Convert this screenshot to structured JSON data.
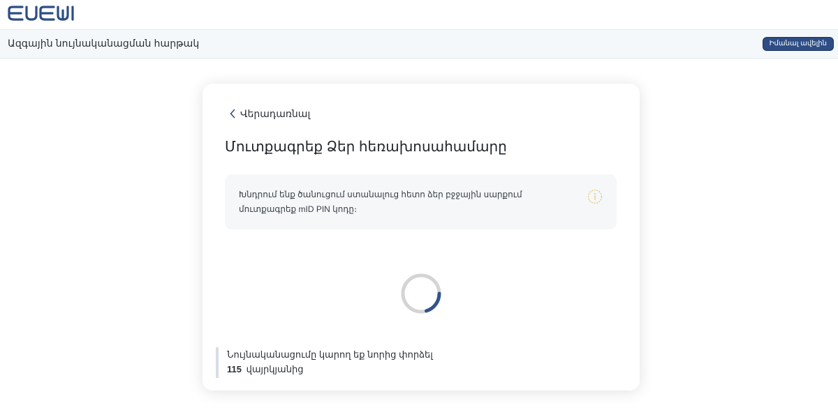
{
  "header": {
    "logo_alt": "ԵԿԵՄ",
    "title": "Ազգային նույնականացման հարթակ",
    "learn_more_label": "Իմանալ ավելին"
  },
  "card": {
    "back_label": "Վերադառնալ",
    "title": "Մուտքագրեք Ձեր հեռախոսահամարը",
    "info_text": "Խնդրում ենք ծանուցում ստանալուց հետո ձեր բջջային սարքում մուտքագրեք mID PIN կոդը։",
    "retry_text": "Նույնականացումը կարող եք նորից փորձել",
    "retry_seconds": "115",
    "retry_suffix": "վայրկյանից"
  },
  "colors": {
    "brand": "#2d4d84",
    "subheader_bg": "#f5f8fa",
    "info_bg": "#f5f7f9",
    "info_icon": "#e8c26a",
    "spinner_track": "#d4d4d4",
    "spinner_arc": "#34538a"
  },
  "icons": {
    "back": "chevron-left-icon",
    "info": "info-icon",
    "loading": "spinner-icon"
  }
}
